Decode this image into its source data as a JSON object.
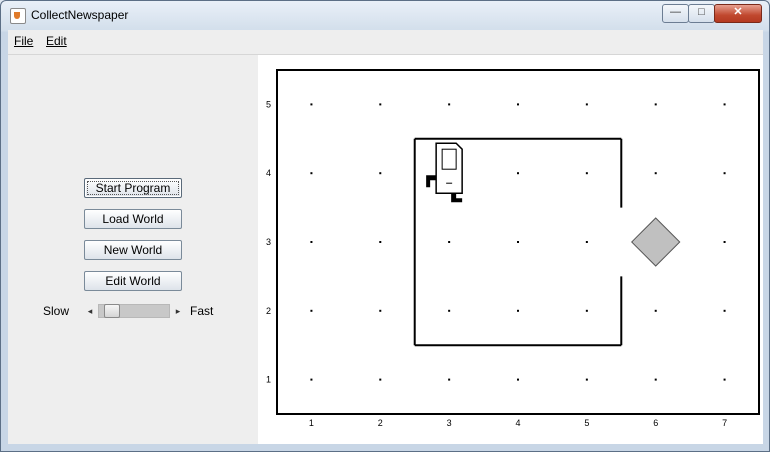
{
  "window": {
    "title": "CollectNewspaper",
    "controls": {
      "minimize": "—",
      "maximize": "□",
      "close": "✕"
    }
  },
  "menu": {
    "items": [
      {
        "label": "File"
      },
      {
        "label": "Edit"
      }
    ]
  },
  "controls": {
    "buttons": [
      {
        "label": "Start Program"
      },
      {
        "label": "Load World"
      },
      {
        "label": "New World"
      },
      {
        "label": "Edit World"
      }
    ],
    "speed": {
      "slow_label": "Slow",
      "fast_label": "Fast",
      "value": 0.1,
      "left_arrow": "◂",
      "right_arrow": "▸"
    }
  },
  "world": {
    "columns": 7,
    "rows": 5,
    "col_labels": [
      "1",
      "2",
      "3",
      "4",
      "5",
      "6",
      "7"
    ],
    "row_labels": [
      "1",
      "2",
      "3",
      "4",
      "5"
    ],
    "karel": {
      "col": 3,
      "row": 4,
      "facing": "east"
    },
    "beepers": [
      {
        "col": 6,
        "row": 3
      }
    ],
    "walls": [
      {
        "type": "h",
        "row_between": [
          4,
          5
        ],
        "cols": [
          3,
          5
        ]
      },
      {
        "type": "h",
        "row_between": [
          1,
          2
        ],
        "cols": [
          3,
          5
        ]
      },
      {
        "type": "v",
        "col_between": [
          2,
          3
        ],
        "rows": [
          2,
          4
        ]
      },
      {
        "type": "v",
        "col_between": [
          5,
          6
        ],
        "rows": [
          4,
          4
        ]
      },
      {
        "type": "v",
        "col_between": [
          5,
          6
        ],
        "rows": [
          2,
          2
        ]
      }
    ]
  },
  "colors": {
    "beeper_fill": "#c0c0c0",
    "wall": "#000000",
    "canvas": "#ffffff"
  }
}
